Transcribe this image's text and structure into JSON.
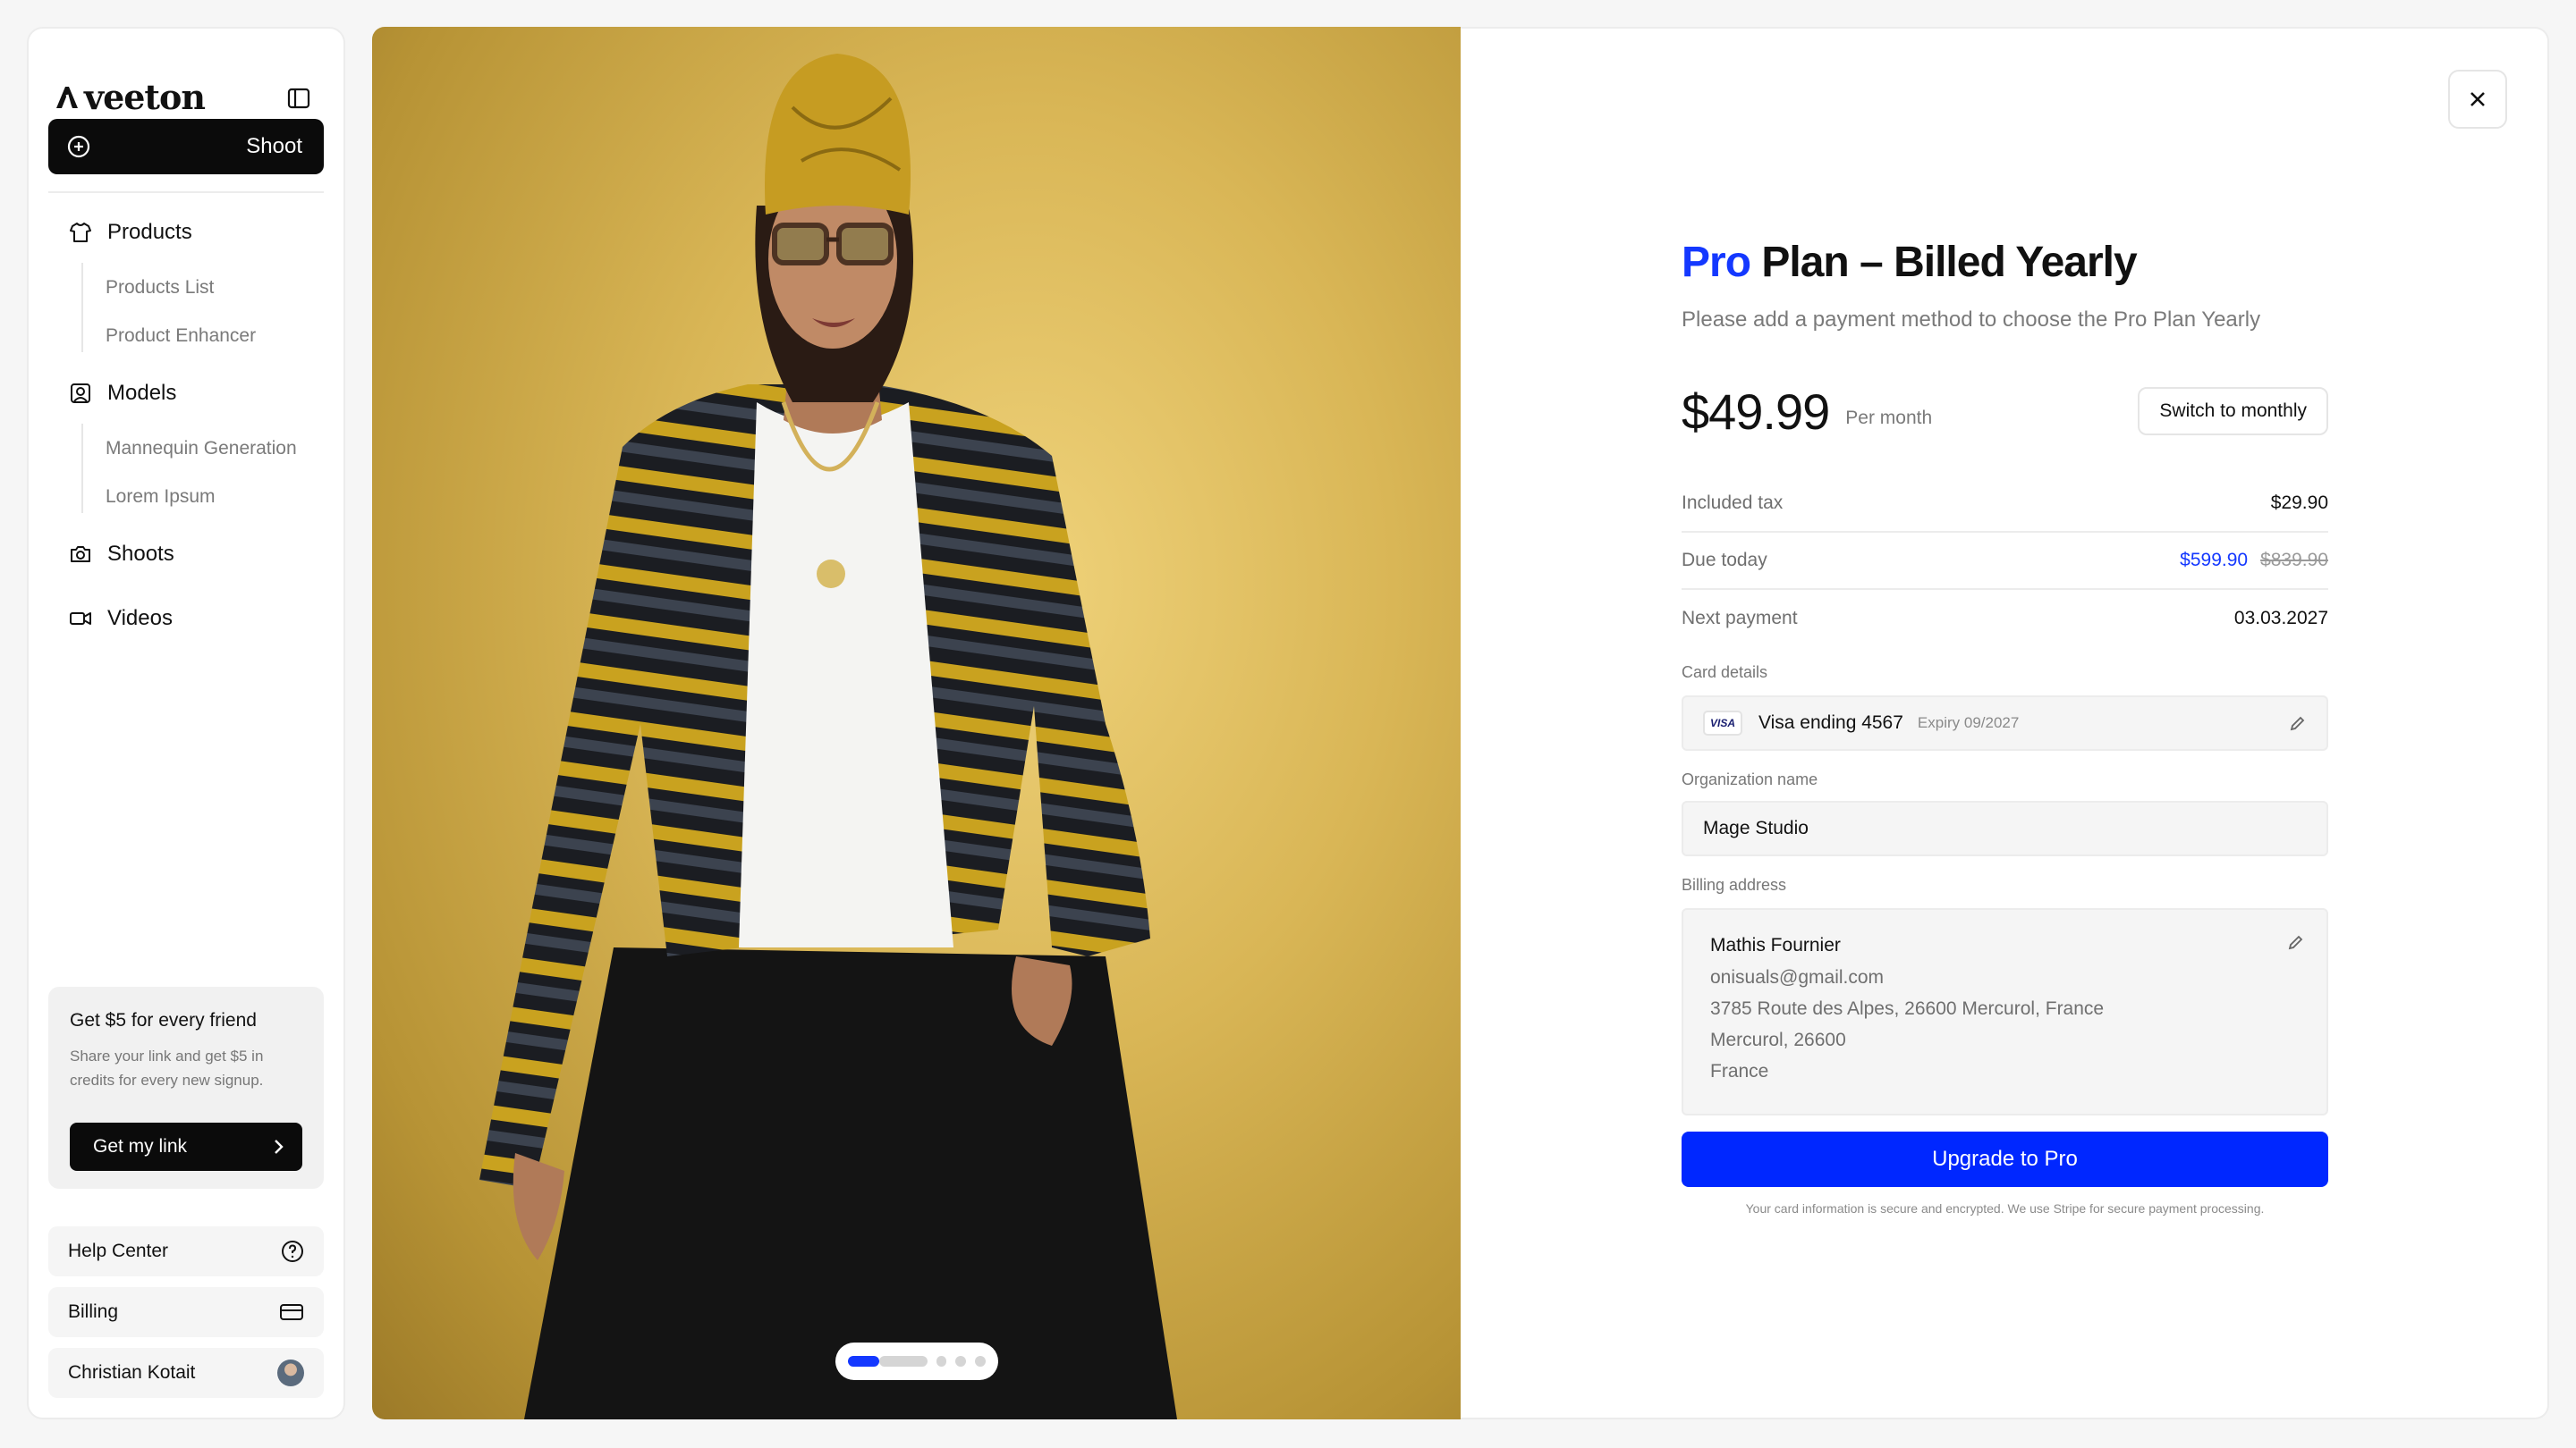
{
  "brand": {
    "name": "veeton"
  },
  "sidebar": {
    "shoot_label": "Shoot",
    "nav": [
      {
        "label": "Products",
        "icon": "shirt-icon",
        "children": [
          "Products List",
          "Product Enhancer"
        ]
      },
      {
        "label": "Models",
        "icon": "portrait-icon",
        "children": [
          "Mannequin Generation",
          "Lorem Ipsum"
        ]
      },
      {
        "label": "Shoots",
        "icon": "camera-icon",
        "children": []
      },
      {
        "label": "Videos",
        "icon": "video-icon",
        "children": []
      }
    ],
    "promo": {
      "title": "Get $5 for every friend",
      "text": "Share your link and get $5 in credits for every new signup.",
      "button": "Get my link"
    },
    "help_center": "Help Center",
    "billing": "Billing",
    "user_name": "Christian Kotait"
  },
  "gallery": {
    "active_index": 1,
    "total": 4
  },
  "checkout": {
    "title_accent": "Pro",
    "title_rest": " Plan – Billed Yearly",
    "subtitle": "Please add a payment method to choose the Pro Plan Yearly",
    "price": "$49.99",
    "period": "Per month",
    "switch_label": "Switch to monthly",
    "included_tax_label": "Included tax",
    "included_tax_value": "$29.90",
    "due_today_label": "Due today",
    "due_today_value": "$599.90",
    "due_today_original": "$839.90",
    "next_payment_label": "Next payment",
    "next_payment_value": "03.03.2027",
    "card_label": "Card details",
    "card_brand": "VISA",
    "card_text": "Visa ending 4567",
    "card_expiry": "Expiry 09/2027",
    "org_label": "Organization name",
    "org_value": "Mage Studio",
    "billing_label": "Billing address",
    "billing_name": "Mathis Fournier",
    "billing_email": "onisuals@gmail.com",
    "billing_street": "3785 Route des Alpes, 26600 Mercurol, France",
    "billing_city": "Mercurol, 26600",
    "billing_country": "France",
    "upgrade_label": "Upgrade to Pro",
    "secure_note": "Your card information is secure and encrypted. We use Stripe for secure payment processing."
  },
  "colors": {
    "accent": "#1438ff",
    "button_dark": "#0b0b0b",
    "photo_bg": "#d9b656"
  }
}
